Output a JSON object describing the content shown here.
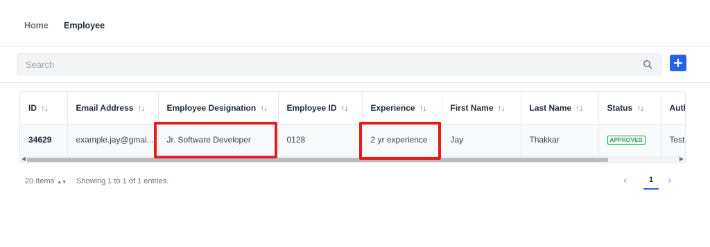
{
  "nav": {
    "home_label": "Home",
    "employee_label": "Employee"
  },
  "search": {
    "placeholder": "Search",
    "value": ""
  },
  "toolbar": {
    "add_icon": "plus-icon"
  },
  "table": {
    "columns": [
      "ID",
      "Email Address",
      "Employee Designation",
      "Employee ID",
      "Experience",
      "First Name",
      "Last Name",
      "Status",
      "Auth"
    ],
    "row": {
      "id": "34629",
      "email": "example.jay@gmai...",
      "designation": "Jr. Software Developer",
      "employee_id": "0128",
      "experience": "2 yr experience",
      "first_name": "Jay",
      "last_name": "Thakkar",
      "status": "APPROVED",
      "auth": "Test"
    },
    "sort_glyph": "↑↓"
  },
  "footer": {
    "page_size": "20 Items",
    "entries_text": "Showing 1 to 1 of 1 entries.",
    "current_page": "1"
  },
  "colors": {
    "accent": "#2563eb",
    "highlight": "#e11d1d",
    "approved": "#16a34a"
  }
}
